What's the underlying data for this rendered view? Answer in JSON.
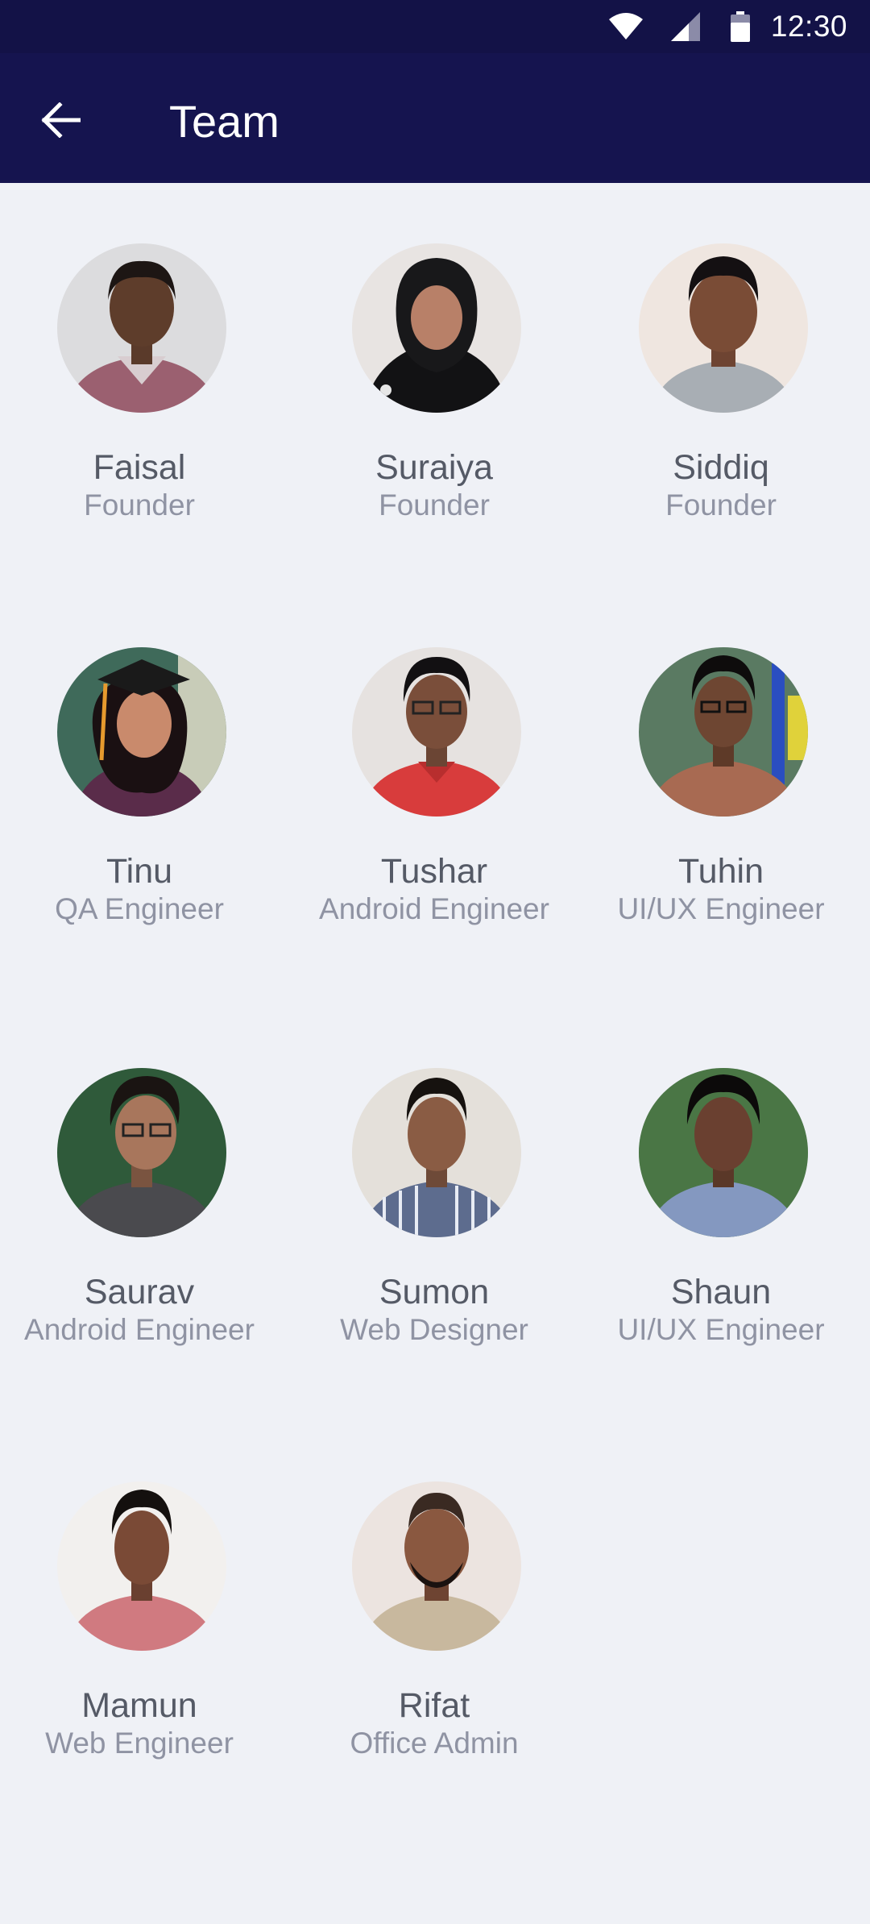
{
  "status_bar": {
    "time": "12:30",
    "icons": [
      "wifi-icon",
      "cell-signal-icon",
      "battery-icon"
    ]
  },
  "app_bar": {
    "back_icon": "arrow-left-icon",
    "title": "Team",
    "background": "#15144f"
  },
  "team": [
    {
      "name": "Faisal",
      "role": "Founder"
    },
    {
      "name": "Suraiya",
      "role": "Founder"
    },
    {
      "name": "Siddiq",
      "role": "Founder"
    },
    {
      "name": "Tinu",
      "role": "QA Engineer"
    },
    {
      "name": "Tushar",
      "role": "Android Engineer"
    },
    {
      "name": "Tuhin",
      "role": "UI/UX Engineer"
    },
    {
      "name": "Saurav",
      "role": "Android Engineer"
    },
    {
      "name": "Sumon",
      "role": "Web Designer"
    },
    {
      "name": "Shaun",
      "role": "UI/UX Engineer"
    },
    {
      "name": "Mamun",
      "role": "Web Engineer"
    },
    {
      "name": "Rifat",
      "role": "Office Admin"
    }
  ],
  "colors": {
    "status_bar": "#131247",
    "background": "#eff1f6",
    "name_text": "#555a66",
    "role_text": "#8f93a3"
  }
}
